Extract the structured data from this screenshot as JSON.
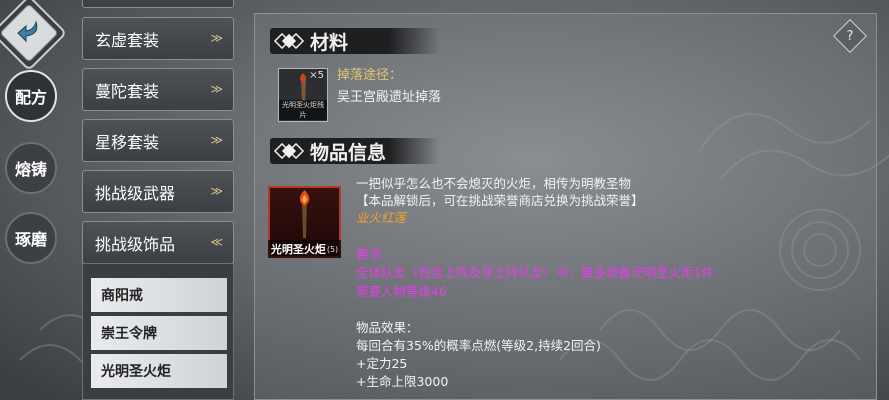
{
  "nav": {
    "back_icon": "curved-back-arrow",
    "tabs": [
      {
        "label": "配方",
        "active": true
      },
      {
        "label": "熔铸",
        "active": false
      },
      {
        "label": "琢磨",
        "active": false
      }
    ]
  },
  "set_list": {
    "items": [
      {
        "label": "玄虚套装"
      },
      {
        "label": "蔓陀套装"
      },
      {
        "label": "星移套装"
      },
      {
        "label": "挑战级武器"
      },
      {
        "label": "挑战级饰品"
      }
    ],
    "sub_items": [
      {
        "label": "商阳戒"
      },
      {
        "label": "崇王令牌"
      },
      {
        "label": "光明圣火炬"
      }
    ]
  },
  "materials": {
    "heading": "材料",
    "material": {
      "name": "光明圣火炬残片",
      "count": "×5"
    },
    "drop_label": "掉落途径：",
    "drop_value": "吴王宫殿遗址掉落"
  },
  "item_info": {
    "heading": "物品信息",
    "item_name": "光明圣火炬",
    "item_quality": "(5)",
    "description": "一把似乎怎么也不会熄灭的火炬，相传为明教圣物",
    "unlock_note": "【本品解锁后，可在挑战荣誉商店兑换为挑战荣誉】",
    "set_name": "业火红莲",
    "requirements_label": "要求：",
    "requirement_1": "全体队友（包含上阵及非上阵队友）中，最多装备光明圣火炬1件",
    "requirement_2": "需要人物等级46",
    "effects_label": "物品效果：",
    "effect_1": "每回合有35%的概率点燃(等级2,持续2回合)",
    "effect_2": "+定力25",
    "effect_3": "+生命上限3000"
  },
  "help_button": "?",
  "colors": {
    "orange": "#f2a32c",
    "magenta": "#e43ee9",
    "gold": "#e2c96f",
    "item_border": "#b23a2a"
  }
}
